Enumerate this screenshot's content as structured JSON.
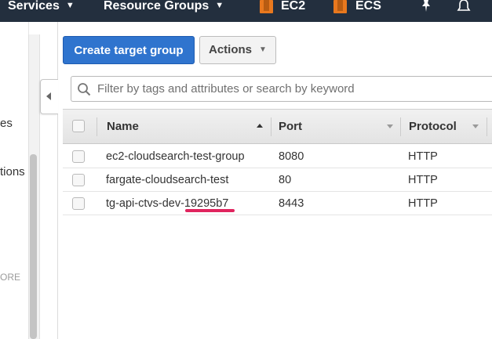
{
  "topbar": {
    "services": "Services",
    "resource_groups": "Resource Groups",
    "ec2": "EC2",
    "ecs": "ECS"
  },
  "sidebar": {
    "partial_items": [
      "es",
      "tions"
    ],
    "more_label": "ORE"
  },
  "toolbar": {
    "create_label": "Create target group",
    "actions_label": "Actions"
  },
  "search": {
    "placeholder": "Filter by tags and attributes or search by keyword"
  },
  "table": {
    "columns": [
      "Name",
      "Port",
      "Protocol"
    ],
    "rows": [
      {
        "name": "ec2-cloudsearch-test-group",
        "port": "8080",
        "protocol": "HTTP"
      },
      {
        "name": "fargate-cloudsearch-test",
        "port": "80",
        "protocol": "HTTP"
      },
      {
        "name": "tg-api-ctvs-dev-19295b7",
        "port": "8443",
        "protocol": "HTTP"
      }
    ]
  },
  "colors": {
    "nav_bg": "#232f3e",
    "primary_button": "#2f74ce",
    "annotation_underline": "#e0245e",
    "service_icon": "#e8781e"
  }
}
